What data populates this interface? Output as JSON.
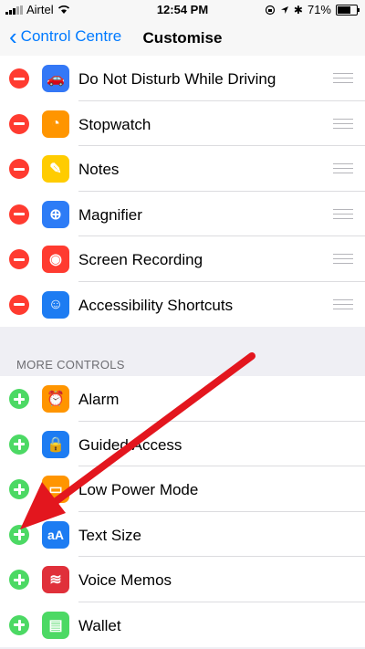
{
  "status_bar": {
    "carrier": "Airtel",
    "time": "12:54 PM",
    "battery": "71%",
    "battery_level": 0.71
  },
  "nav": {
    "back_label": "Control Centre",
    "title": "Customise"
  },
  "included": [
    {
      "label": "Do Not Disturb While Driving",
      "icon": "car-icon",
      "color": "#3478f6"
    },
    {
      "label": "Stopwatch",
      "icon": "stopwatch-icon",
      "color": "#ff9500"
    },
    {
      "label": "Notes",
      "icon": "notes-icon",
      "color": "#ffcc00"
    },
    {
      "label": "Magnifier",
      "icon": "magnifier-icon",
      "color": "#2d7cf6"
    },
    {
      "label": "Screen Recording",
      "icon": "record-icon",
      "color": "#ff3b30"
    },
    {
      "label": "Accessibility Shortcuts",
      "icon": "accessibility-icon",
      "color": "#1d7cf2"
    }
  ],
  "more_controls": {
    "header": "MORE CONTROLS",
    "items": [
      {
        "label": "Alarm",
        "icon": "alarm-icon",
        "color": "#ff9500"
      },
      {
        "label": "Guided Access",
        "icon": "lock-icon",
        "color": "#1d7cf2"
      },
      {
        "label": "Low Power Mode",
        "icon": "battery-icon",
        "color": "#ff9500"
      },
      {
        "label": "Text Size",
        "icon": "text-size-icon",
        "color": "#1d7cf2"
      },
      {
        "label": "Voice Memos",
        "icon": "waveform-icon",
        "color": "#e0303a"
      },
      {
        "label": "Wallet",
        "icon": "wallet-icon",
        "color": "#4cd964"
      }
    ]
  },
  "colors": {
    "accent": "#007aff",
    "remove": "#ff3b30",
    "add": "#4cd964",
    "annotation_arrow": "#e3161e"
  }
}
